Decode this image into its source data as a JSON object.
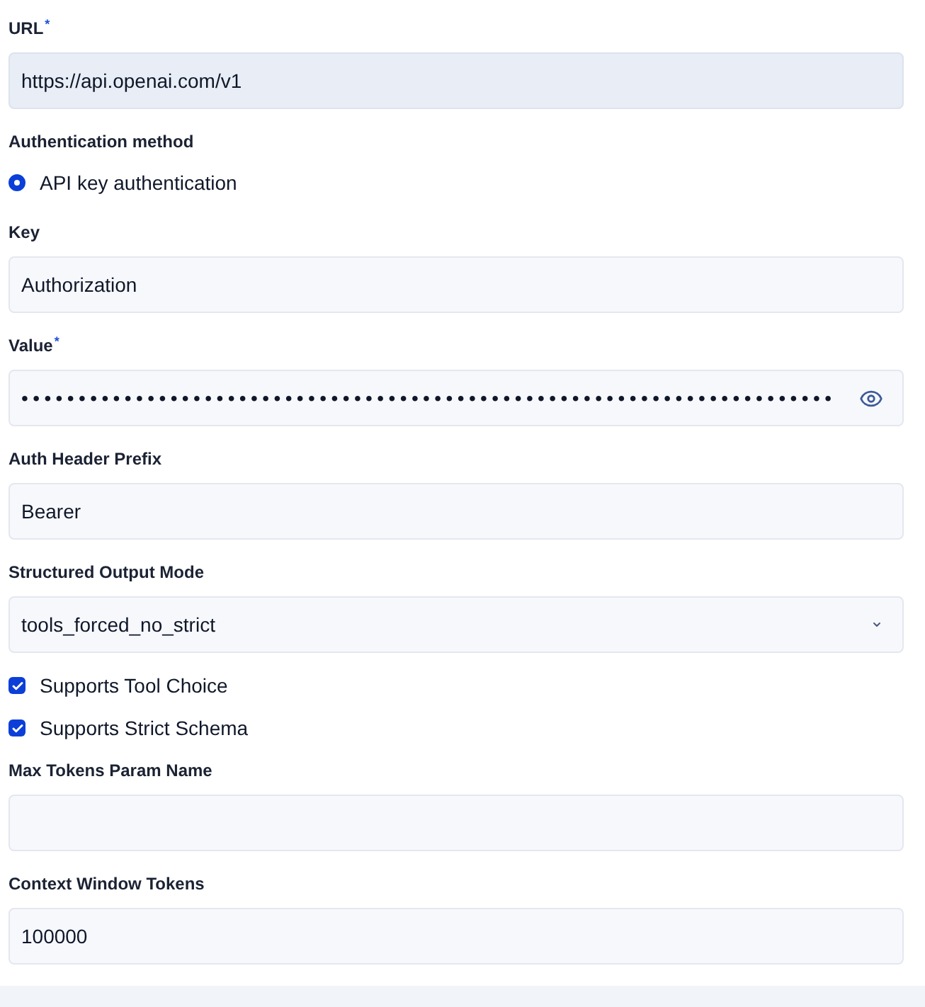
{
  "fields": [
    {
      "kind": "text",
      "label": "URL$^{*}$",
      "value": "https://api.openai.com/v1",
      "disabled": true
    },
    {
      "kind": "radio-group",
      "label": "Authentication method",
      "options": [
        {
          "label": "API key authentication",
          "selected": true
        }
      ]
    },
    {
      "kind": "text",
      "label": "Key",
      "value": "Authorization",
      "disabled": false
    },
    {
      "kind": "password",
      "label": "Value$^{*}$",
      "value": "•••••••••••••••••••••••••••••••••••••••••••••••••••••••••••••••••••••••"
    },
    {
      "kind": "text",
      "label": "Auth Header Prefix",
      "value": "Bearer",
      "disabled": false
    },
    {
      "kind": "select",
      "label": "Structured Output Mode",
      "value": "tools_forced_no_strict"
    },
    {
      "kind": "checkbox",
      "label": "Supports Tool Choice",
      "checked": true
    },
    {
      "kind": "checkbox",
      "label": "Supports Strict Schema",
      "checked": true
    },
    {
      "kind": "text",
      "label": "Max Tokens Param Name",
      "disabled": false
    },
    {
      "kind": "text",
      "label": "Context Window Tokens",
      "value": "100000",
      "disabled": false
    }
  ]
}
